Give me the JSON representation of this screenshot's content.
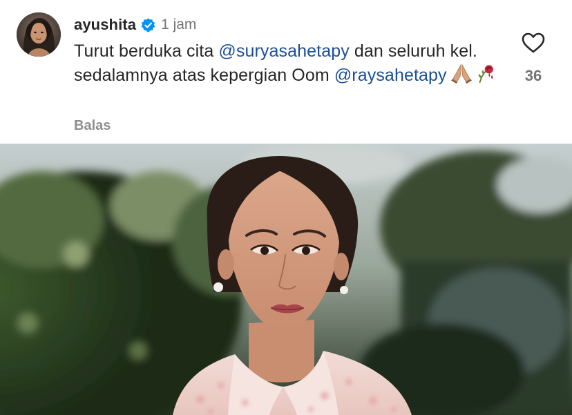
{
  "comment": {
    "username": "ayushita",
    "verified_icon": "verified-badge-icon",
    "timestamp": "1 jam",
    "text": {
      "part1": "Turut berduka cita ",
      "mention1": "@suryasahetapy",
      "part2": " dan seluruh kel. sedalamnya atas kepergian Oom ",
      "mention2": "@raysahetapy",
      "emoji1": "folded-hands-icon",
      "emoji2": "wilted-flower-icon"
    },
    "reply_label": "Balas",
    "like_icon": "heart-outline-icon",
    "like_count": "36"
  },
  "post_image": {
    "subject": "woman-portrait-photo",
    "accent_colors": {
      "mention": "#1c4f96",
      "meta": "#737373",
      "verified": "#0095f6"
    }
  }
}
